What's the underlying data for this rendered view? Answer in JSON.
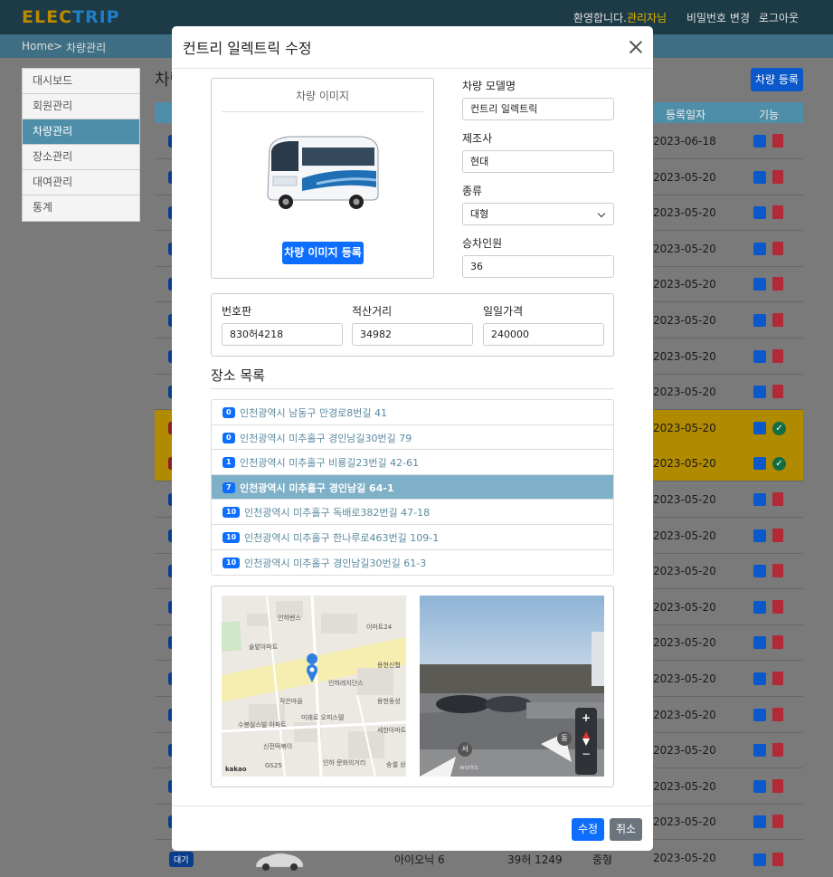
{
  "header": {
    "logo_part1": "ELEC",
    "logo_part2": "TRIP",
    "welcome": "환영합니다.",
    "user": "관리자님",
    "change_password": "비밀번호 변경",
    "logout": "로그아웃"
  },
  "breadcrumb": {
    "home": "Home",
    "separator": ">",
    "current": "차량관리"
  },
  "sidebar": {
    "items": [
      {
        "label": "대시보드"
      },
      {
        "label": "회원관리"
      },
      {
        "label": "차량관리"
      },
      {
        "label": "장소관리"
      },
      {
        "label": "대여관리"
      },
      {
        "label": "통계"
      }
    ]
  },
  "page": {
    "title": "차량관리",
    "register_button": "차량 등록",
    "columns": {
      "reg_date": "등록일자",
      "actions": "기능"
    },
    "rows": [
      {
        "date": "2023-06-18",
        "status": "normal"
      },
      {
        "date": "2023-05-20",
        "status": "normal"
      },
      {
        "date": "2023-05-20",
        "status": "normal"
      },
      {
        "date": "2023-05-20",
        "status": "normal"
      },
      {
        "date": "2023-05-20",
        "status": "normal"
      },
      {
        "date": "2023-05-20",
        "status": "normal"
      },
      {
        "date": "2023-05-20",
        "status": "normal"
      },
      {
        "date": "2023-05-20",
        "status": "normal"
      },
      {
        "date": "2023-05-20",
        "status": "highlight"
      },
      {
        "date": "2023-05-20",
        "status": "highlight"
      },
      {
        "date": "2023-05-20",
        "status": "normal"
      },
      {
        "date": "2023-05-20",
        "status": "normal"
      },
      {
        "date": "2023-05-20",
        "status": "normal"
      },
      {
        "date": "2023-05-20",
        "status": "normal"
      },
      {
        "date": "2023-05-20",
        "status": "normal"
      },
      {
        "date": "2023-05-20",
        "status": "normal"
      },
      {
        "date": "2023-05-20",
        "status": "normal"
      },
      {
        "date": "2023-05-20",
        "status": "normal"
      },
      {
        "date": "2023-05-20",
        "status": "normal"
      },
      {
        "date": "2023-05-20",
        "status": "normal"
      }
    ],
    "last_row": {
      "badge": "대기",
      "model": "아이오닉 6",
      "plate": "39허 1249",
      "type": "중형",
      "date": "2023-05-20"
    }
  },
  "modal": {
    "title": "컨트리 일렉트릭 수정",
    "image_caption": "차량 이미지",
    "image_button": "차량 이미지 등록",
    "fields": {
      "model_label": "차량 모델명",
      "model_value": "컨트리 일렉트릭",
      "maker_label": "제조사",
      "maker_value": "현대",
      "type_label": "종류",
      "type_value": "대형",
      "seats_label": "승차인원",
      "seats_value": "36",
      "plate_label": "번호판",
      "plate_value": "830허4218",
      "mileage_label": "적산거리",
      "mileage_value": "34982",
      "price_label": "일일가격",
      "price_value": "240000"
    },
    "location_title": "장소 목록",
    "locations": [
      {
        "count": "0",
        "address": "인천광역시 남동구 만경로8번길 41",
        "active": false
      },
      {
        "count": "0",
        "address": "인천광역시 미추홀구 경인남길30번길 79",
        "active": false
      },
      {
        "count": "1",
        "address": "인천광역시 미추홀구 비룡길23번길 42-61",
        "active": false
      },
      {
        "count": "7",
        "address": "인천광역시 미추홀구 경인남길 64-1",
        "active": true
      },
      {
        "count": "10",
        "address": "인천광역시 미추홀구 독배로382번길 47-18",
        "active": false
      },
      {
        "count": "10",
        "address": "인천광역시 미추홀구 한나루로463번길 109-1",
        "active": false
      },
      {
        "count": "10",
        "address": "인천광역시 미추홀구 경인남길30번길 61-3",
        "active": false
      }
    ],
    "map_labels": {
      "l1": "인하벤스",
      "l2": "이마트24",
      "l3": "솔밭아파트",
      "l4": "용현신협",
      "l5": "인하레지던스",
      "l6": "작은마을",
      "l7": "용현동성",
      "l8": "미래로 오피스텔",
      "l9": "수봉실스빌 아파트",
      "l10": "세한아파트",
      "l11": "신전떡볶이",
      "l12": "인하 문화의거리",
      "l13": "GS25",
      "l14": "kakao",
      "l15": "숭셀 상점"
    },
    "street_labels": {
      "west": "서",
      "east": "동",
      "works": "works",
      "zoom_in": "+",
      "zoom_out": "−"
    },
    "save_button": "수정",
    "cancel_button": "취소"
  },
  "colors": {
    "topbar": "#1d3a47",
    "primary": "#0d6efd",
    "list_active": "#7eb0c8",
    "secondary": "#6c757d"
  }
}
